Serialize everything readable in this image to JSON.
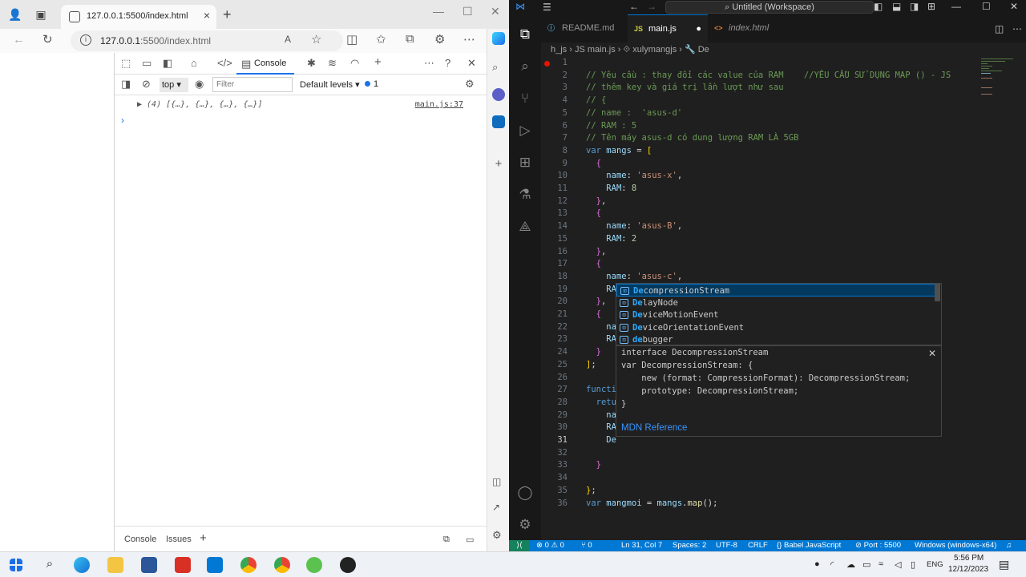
{
  "browser": {
    "tab_title": "127.0.0.1:5500/index.html",
    "url_host": "127.0.0.1",
    "url_path": ":5500/index.html",
    "devtools": {
      "console_tab_label": "Console",
      "context": "top",
      "filter_placeholder": "Filter",
      "levels_label": "Default levels",
      "issue_count": "1",
      "log_text": "▶ (4) [{…}, {…}, {…}, {…}]",
      "log_source": "main.js:37",
      "prompt": "›",
      "drawer_tabs": [
        "Console",
        "Issues"
      ]
    }
  },
  "vscode": {
    "command_center": "Untitled (Workspace)",
    "tabs": [
      {
        "label": "README.md",
        "icon": "ⓘ"
      },
      {
        "label": "main.js",
        "icon": "JS"
      },
      {
        "label": "index.html",
        "icon": "<>"
      }
    ],
    "breadcrumb": "h_js  ›  JS main.js  ›  ⟐ xulymangjs  ›  🔧 De",
    "editor_lines": [
      {
        "n": "1",
        "html": ""
      },
      {
        "n": "2",
        "html": "<span class='cm'>// Yêu cầu : thay đổi các value của RAM    //YÊU CẦU SỬ DỤNG MAP () - JS</span>"
      },
      {
        "n": "3",
        "html": "<span class='cm'>// thêm key và giá trị lần lượt như sau</span>"
      },
      {
        "n": "4",
        "html": "<span class='cm'>// {</span>"
      },
      {
        "n": "5",
        "html": "<span class='cm'>// name :  'asus-d'</span>"
      },
      {
        "n": "6",
        "html": "<span class='cm'>// RAM : 5</span>"
      },
      {
        "n": "7",
        "html": "<span class='cm'>// Tên máy asus-d có dung lượng RAM LÀ 5GB</span>"
      },
      {
        "n": "8",
        "html": "<span class='kw'>var</span> <span class='vr'>mangs</span> = <span class='br'>[</span>"
      },
      {
        "n": "9",
        "html": "  <span class='br2'>{</span>"
      },
      {
        "n": "10",
        "html": "    <span class='vr'>name</span>: <span class='st'>'asus-x'</span>,"
      },
      {
        "n": "11",
        "html": "    <span class='vr'>RAM</span>: <span class='nm'>8</span>"
      },
      {
        "n": "12",
        "html": "  <span class='br2'>}</span>,"
      },
      {
        "n": "13",
        "html": "  <span class='br2'>{</span>"
      },
      {
        "n": "14",
        "html": "    <span class='vr'>name</span>: <span class='st'>'asus-B'</span>,"
      },
      {
        "n": "15",
        "html": "    <span class='vr'>RAM</span>: <span class='nm'>2</span>"
      },
      {
        "n": "16",
        "html": "  <span class='br2'>}</span>,"
      },
      {
        "n": "17",
        "html": "  <span class='br2'>{</span>"
      },
      {
        "n": "18",
        "html": "    <span class='vr'>name</span>: <span class='st'>'asus-c'</span>,"
      },
      {
        "n": "19",
        "html": "    <span class='vr'>RA</span>"
      },
      {
        "n": "20",
        "html": "  <span class='br2'>}</span>,"
      },
      {
        "n": "21",
        "html": "  <span class='br2'>{</span>"
      },
      {
        "n": "22",
        "html": "    <span class='vr'>na</span>"
      },
      {
        "n": "23",
        "html": "    <span class='vr'>RA</span>"
      },
      {
        "n": "24",
        "html": "  <span class='br2'>}</span>"
      },
      {
        "n": "25",
        "html": "<span class='br'>]</span>;"
      },
      {
        "n": "26",
        "html": ""
      },
      {
        "n": "27",
        "html": "<span class='kw'>functi</span>"
      },
      {
        "n": "28",
        "html": "  <span class='kw'>retu</span>"
      },
      {
        "n": "29",
        "html": "    <span class='vr'>na</span>"
      },
      {
        "n": "30",
        "html": "    <span class='vr'>RA</span>"
      },
      {
        "n": "31",
        "html": "    <span class='vr'>De</span>"
      },
      {
        "n": "32",
        "html": ""
      },
      {
        "n": "33",
        "html": "  <span class='br2'>}</span>"
      },
      {
        "n": "34",
        "html": ""
      },
      {
        "n": "35",
        "html": "<span class='br'>}</span>;"
      },
      {
        "n": "36",
        "html": "<span class='kw'>var</span> <span class='vr'>mangmoi</span> = <span class='vr'>mangs</span>.<span class='fn'>map</span>();"
      }
    ],
    "current_line": "31",
    "suggestions": [
      {
        "prefix": "De",
        "rest": "compressionStream",
        "selected": true
      },
      {
        "prefix": "De",
        "rest": "layNode",
        "selected": false
      },
      {
        "prefix": "De",
        "rest": "viceMotionEvent",
        "selected": false
      },
      {
        "prefix": "De",
        "rest": "viceOrientationEvent",
        "selected": false
      },
      {
        "prefix": "de",
        "rest": "bugger",
        "selected": false
      }
    ],
    "details": {
      "l1": "interface DecompressionStream",
      "l2": "var DecompressionStream: {",
      "l3": "    new (format: CompressionFormat): DecompressionStream;",
      "l4": "    prototype: DecompressionStream;",
      "l5": "}",
      "link": "MDN Reference"
    },
    "status": {
      "problems": "⊗ 0 ⚠ 0",
      "ports": "⑂ 0",
      "position": "Ln 31, Col 7",
      "spaces": "Spaces: 2",
      "encoding": "UTF-8",
      "eol": "CRLF",
      "language": "{} Babel JavaScript",
      "port": "⊘ Port : 5500",
      "platform": "Windows (windows-x64)"
    }
  },
  "taskbar": {
    "lang": "ENG",
    "time": "5:56 PM",
    "date": "12/12/2023"
  }
}
